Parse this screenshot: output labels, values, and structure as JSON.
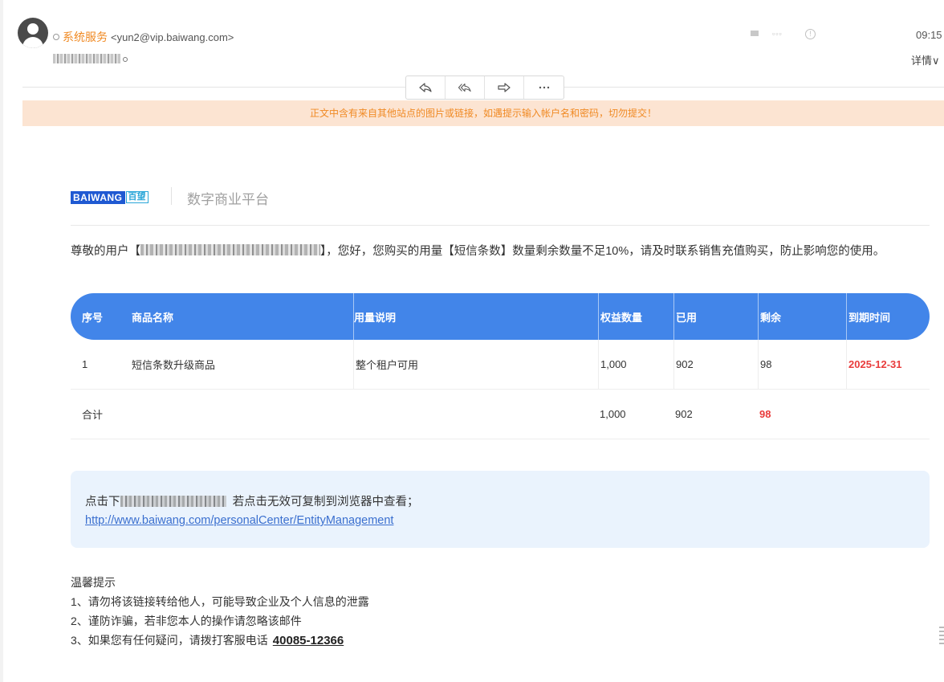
{
  "header": {
    "sender_name": "系统服务",
    "sender_email": "<yun2@vip.baiwang.com>",
    "time": "09:15",
    "details_label": "详情∨"
  },
  "warning": "正文中含有来自其他站点的图片或链接，如遇提示输入帐户名和密码，切勿提交！",
  "brand": {
    "logo_text": "BAIWANG",
    "logo_cn": "百望",
    "platform": "数字商业平台"
  },
  "greeting": {
    "prefix": "尊敬的用户【",
    "suffix": "】，您好，您购买的用量【短信条数】数量剩余数量不足10%，请及时联系销售充值购买，防止影响您的使用。"
  },
  "table": {
    "headers": [
      "序号",
      "商品名称",
      "用量说明",
      "权益数量",
      "已用",
      "剩余",
      "到期时间"
    ],
    "rows": [
      [
        "1",
        "短信条数升级商品",
        "整个租户可用",
        "1,000",
        "902",
        "98",
        "2025-12-31"
      ]
    ],
    "total": {
      "label": "合计",
      "quantity": "1,000",
      "used": "902",
      "remaining": "98"
    }
  },
  "link_box": {
    "instruction_prefix": "点击下",
    "instruction_suffix": "若点击无效可复制到浏览器中查看；",
    "url": "http://www.baiwang.com/personalCenter/EntityManagement"
  },
  "tips": {
    "title": "温馨提示",
    "items": [
      "1、请勿将该链接转给他人，可能导致企业及个人信息的泄露",
      "2、谨防诈骗，若非您本人的操作请忽略该邮件",
      "3、如果您有任何疑问，请拨打客服电话"
    ],
    "phone": "40085-12366"
  },
  "colors": {
    "accent_orange": "#f08a24",
    "table_header_blue": "#4285e9",
    "warning_bg": "#fce4d2",
    "alert_red": "#e93c3c",
    "link_blue": "#3a6fcf"
  },
  "icons": [
    "avatar-icon",
    "flag-icon",
    "more-icon",
    "info-icon",
    "reply-icon",
    "reply-all-icon",
    "forward-icon",
    "ellipsis-icon"
  ]
}
